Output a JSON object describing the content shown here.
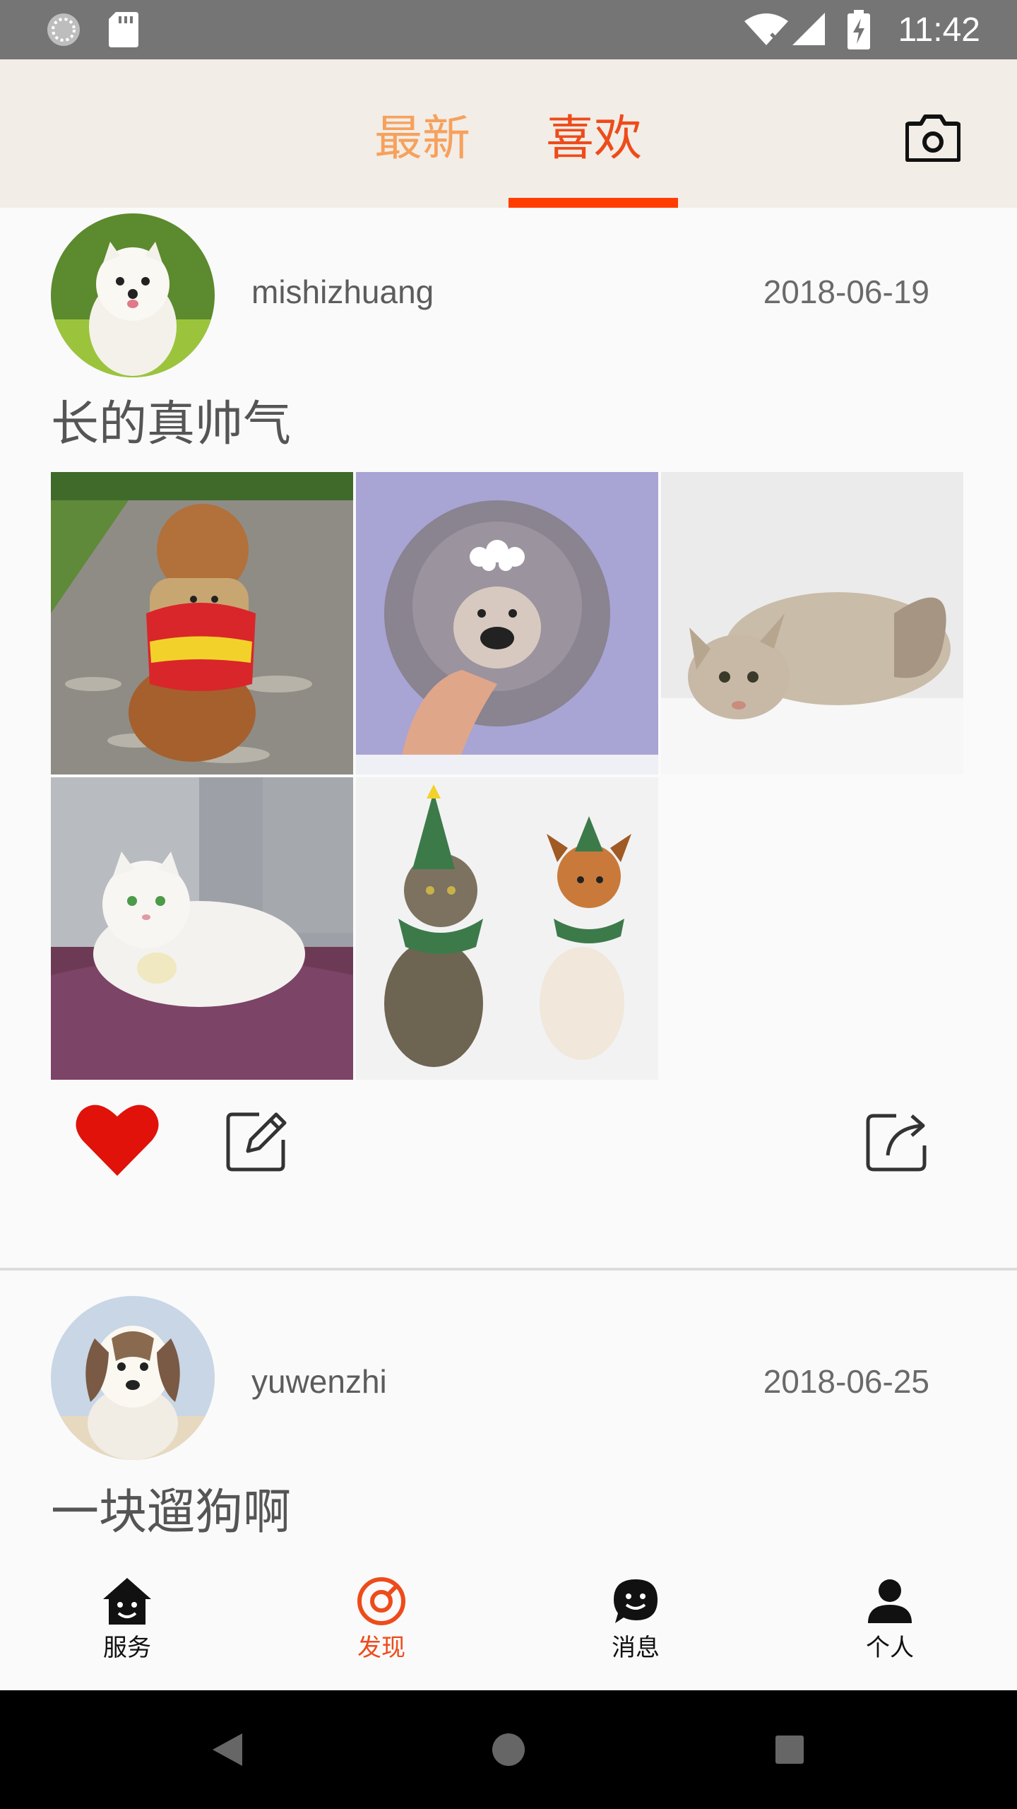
{
  "status_bar": {
    "time": "11:42",
    "icons": [
      "sync-icon",
      "sd-card-icon",
      "wifi-off-icon",
      "signal-icon",
      "battery-charging-icon"
    ]
  },
  "top_tabs": {
    "tabs": [
      {
        "label": "最新",
        "active": false
      },
      {
        "label": "喜欢",
        "active": true
      }
    ],
    "camera_icon": "camera-icon",
    "accent_color": "#ff3d00",
    "inactive_color": "#f6a15d"
  },
  "posts": [
    {
      "username": "mishizhuang",
      "date": "2018-06-19",
      "text": "长的真帅气",
      "images": [
        "poodle-in-bear-costume",
        "grey-poodle-with-flower",
        "sphynx-cat-crouching",
        "white-cat-on-sofa",
        "cat-and-dog-in-christmas-hats"
      ],
      "liked": true,
      "actions": [
        "heart-icon",
        "edit-icon",
        "share-icon"
      ]
    },
    {
      "username": "yuwenzhi",
      "date": "2018-06-25",
      "text": "一块遛狗啊"
    }
  ],
  "bottom_nav": {
    "items": [
      {
        "label": "服务",
        "icon": "home-face-icon",
        "active": false
      },
      {
        "label": "发现",
        "icon": "discover-icon",
        "active": true
      },
      {
        "label": "消息",
        "icon": "message-icon",
        "active": false
      },
      {
        "label": "个人",
        "icon": "person-icon",
        "active": false
      }
    ]
  },
  "system_nav": [
    "back-icon",
    "home-icon",
    "recents-icon"
  ]
}
